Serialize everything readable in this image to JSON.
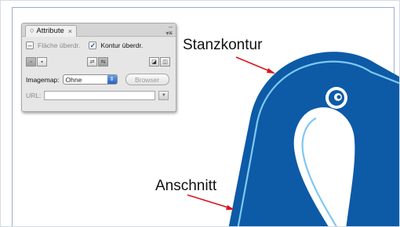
{
  "callouts": {
    "stanzkontur": "Stanzkontur",
    "anschnitt": "Anschnitt"
  },
  "colors": {
    "penguin_blue": "#0d5aa7",
    "contour_line": "#7fc8f0",
    "arrow_red": "#d8141c"
  },
  "panel": {
    "tab_label": "Attribute",
    "fill_overprint_label": "Fläche überdr.",
    "fill_overprint_checked": false,
    "stroke_overprint_label": "Kontur überdr.",
    "stroke_overprint_checked": true,
    "imagemap_label": "Imagemap:",
    "imagemap_value": "Ohne",
    "browser_button": "Browser",
    "url_label": "URL:",
    "url_value": ""
  },
  "icons": {
    "tab_diamond": "◇",
    "tab_close": "×",
    "window_close": "×",
    "panel_menu": "▾≡",
    "select_arrow": "⇕",
    "url_dropdown": "▼"
  }
}
